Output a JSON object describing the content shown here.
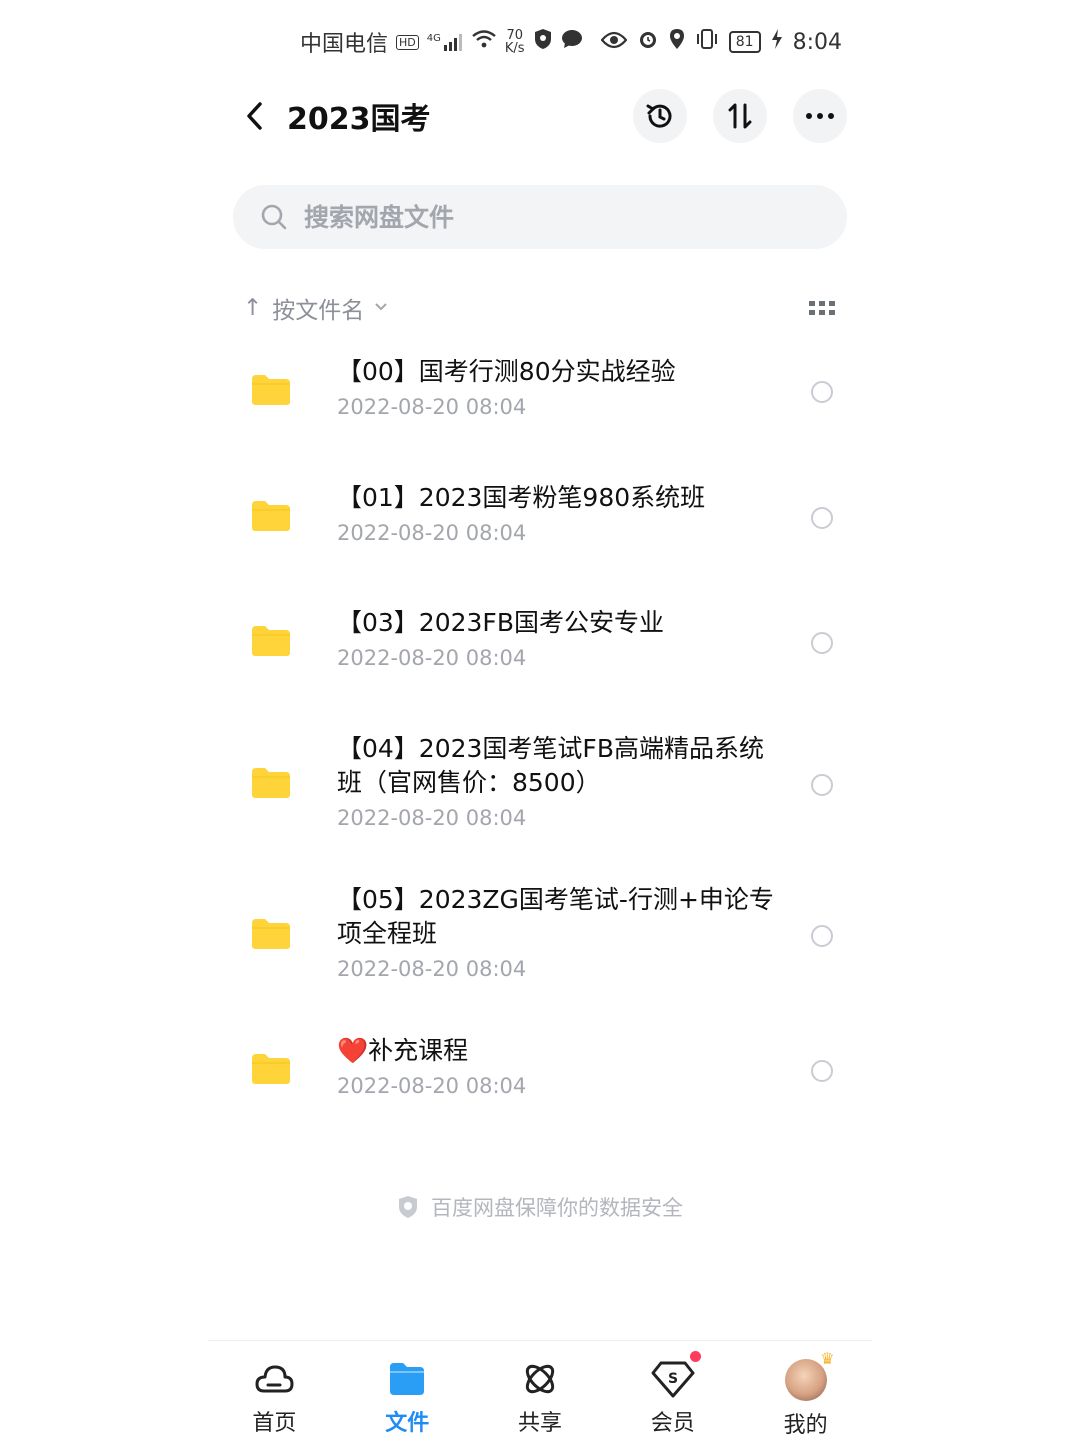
{
  "status_bar": {
    "carrier": "中国电信",
    "hd": "HD",
    "network": "4G",
    "speed_value": "70",
    "speed_unit": "K/s",
    "battery": "81",
    "time": "8:04"
  },
  "header": {
    "title": "2023国考"
  },
  "search": {
    "placeholder": "搜索网盘文件"
  },
  "sort": {
    "arrow": "↑",
    "label": "按文件名"
  },
  "files": [
    {
      "name": "【00】国考行测80分实战经验",
      "date": "2022-08-20  08:04"
    },
    {
      "name": "【01】2023国考粉笔980系统班",
      "date": "2022-08-20  08:04"
    },
    {
      "name": "【03】2023FB国考公安专业",
      "date": "2022-08-20  08:04"
    },
    {
      "name": "【04】2023国考笔试FB高端精品系统班（官网售价：8500）",
      "date": "2022-08-20  08:04"
    },
    {
      "name": "【05】2023ZG国考笔试-行测+申论专项全程班",
      "date": "2022-08-20  08:04"
    },
    {
      "name": "❤️补充课程",
      "date": "2022-08-20  08:04"
    }
  ],
  "footer_note": "百度网盘保障你的数据安全",
  "tabs": [
    {
      "label": "首页"
    },
    {
      "label": "文件"
    },
    {
      "label": "共享"
    },
    {
      "label": "会员"
    },
    {
      "label": "我的"
    }
  ],
  "colors": {
    "accent": "#1f8cf5",
    "folder": "#ffd43b",
    "secondary_text": "#a3a6ad",
    "badge": "#ff3b5c"
  },
  "icons": [
    "back-icon",
    "history-icon",
    "sort-icon",
    "more-icon",
    "search-icon",
    "grid-view-icon",
    "folder-icon",
    "shield-icon",
    "cloud-icon",
    "folder-tab-icon",
    "share-orbit-icon",
    "vip-diamond-icon"
  ]
}
